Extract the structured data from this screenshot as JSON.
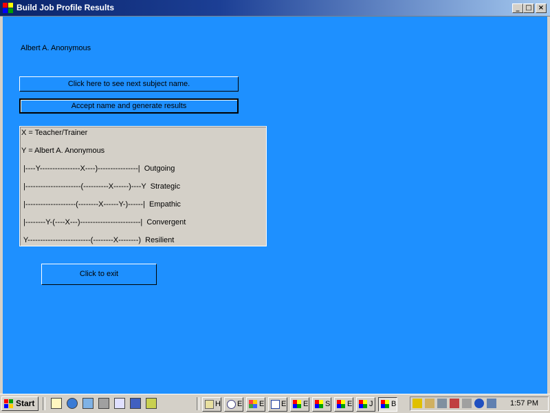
{
  "window": {
    "title": "Build Job Profile Results"
  },
  "window_controls": {
    "minimize": "_",
    "maximize": "□",
    "close": "×"
  },
  "subject_name": "Albert A. Anonymous",
  "buttons": {
    "next_subject": "Click here to see next subject name.",
    "accept": "Accept name and generate results",
    "exit": "Click to exit"
  },
  "results": {
    "lines": [
      "X = Teacher/Trainer",
      "Y = Albert A. Anonymous",
      " |----Y----------------X----)----------------|  Outgoing",
      " |----------------------(----------X------)----Y  Strategic",
      " |--------------------(--------X------Y-)------|  Empathic",
      " |--------Y-(----X---)------------------------|  Convergent",
      " Y-------------------------(--------X--------)  Resilient"
    ]
  },
  "taskbar": {
    "start_label": "Start",
    "quick_launch": [
      "desktop-icon",
      "ie-icon",
      "network-icon",
      "grid-app-icon",
      "tool-icon",
      "cursor-icon",
      "camera-icon"
    ],
    "tasks": [
      {
        "label": "H",
        "icon": "explorer-icon"
      },
      {
        "label": "E",
        "icon": "search-icon"
      },
      {
        "label": "E",
        "icon": "colorful-app-icon"
      },
      {
        "label": "E",
        "icon": "word-icon"
      },
      {
        "label": "E",
        "icon": "app-window-icon"
      },
      {
        "label": "S",
        "icon": "app-window-icon"
      },
      {
        "label": "E",
        "icon": "app-window-icon"
      },
      {
        "label": "J",
        "icon": "app-window-icon"
      },
      {
        "label": "B",
        "icon": "app-window-icon",
        "active": true
      }
    ],
    "clock": "1:57 PM"
  },
  "colors": {
    "client_bg": "#1e90ff",
    "title_bar": "#0a246a",
    "face": "#d4d0c8"
  }
}
